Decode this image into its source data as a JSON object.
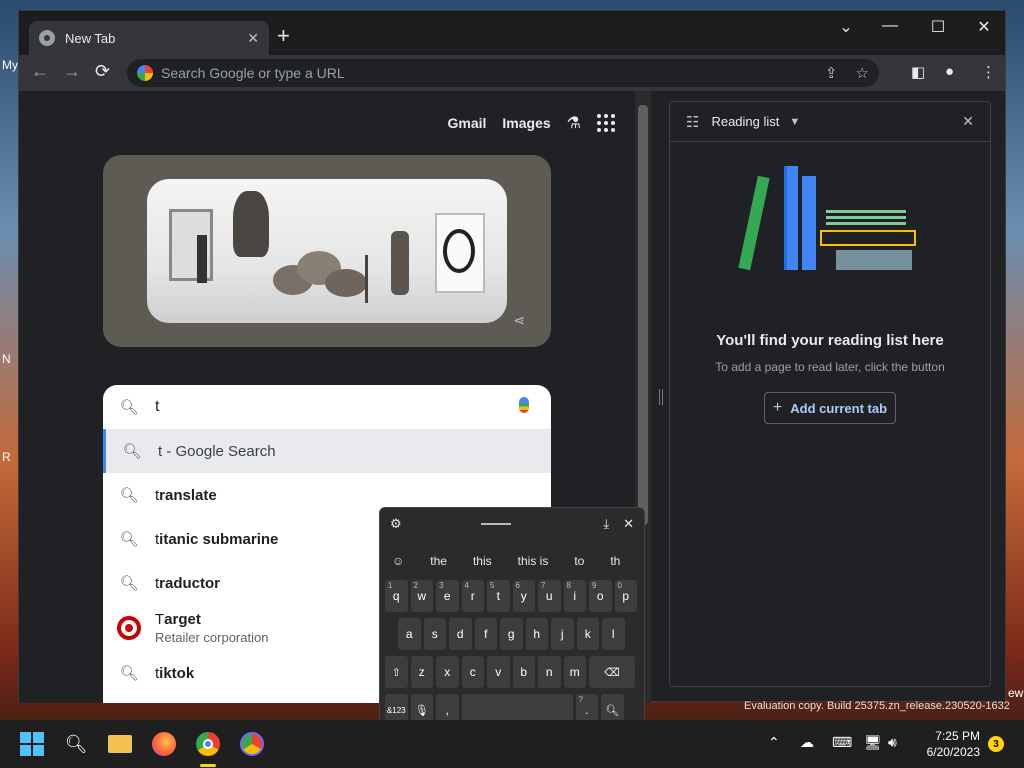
{
  "desktop": {
    "frags": [
      "My",
      "N",
      "R"
    ],
    "right_frag": "ew"
  },
  "tab": {
    "title": "New Tab",
    "close": "✕",
    "new": "+"
  },
  "window_controls": {
    "chevron": "⌄",
    "min": "—",
    "max": "☐",
    "close": "✕"
  },
  "toolbar": {
    "back": "←",
    "forward": "→",
    "reload": "⟳",
    "omnibox_placeholder": "Search Google or type a URL"
  },
  "page": {
    "top_links": [
      "Gmail",
      "Images"
    ],
    "search": {
      "typed": "t",
      "selected": {
        "bold": "t",
        "rest": " - Google Search"
      },
      "suggestions": [
        {
          "prefix": "t",
          "rest": "ranslate"
        },
        {
          "prefix": "t",
          "rest": "itanic submarine"
        },
        {
          "prefix": "t",
          "rest": "raductor"
        },
        {
          "prefix": "T",
          "rest": "arget",
          "sub": "Retailer corporation",
          "logo_text": "target"
        },
        {
          "prefix": "t",
          "rest": "iktok"
        }
      ]
    }
  },
  "side_panel": {
    "title": "Reading list",
    "heading": "You'll find your reading list here",
    "desc": "To add a page to read later, click the button",
    "button": "Add current tab"
  },
  "keyboard": {
    "suggestions": [
      "the",
      "this",
      "this is",
      "to",
      "th"
    ],
    "row1": [
      {
        "k": "q",
        "n": "1"
      },
      {
        "k": "w",
        "n": "2"
      },
      {
        "k": "e",
        "n": "3"
      },
      {
        "k": "r",
        "n": "4"
      },
      {
        "k": "t",
        "n": "5"
      },
      {
        "k": "y",
        "n": "6"
      },
      {
        "k": "u",
        "n": "7"
      },
      {
        "k": "i",
        "n": "8"
      },
      {
        "k": "o",
        "n": "9"
      },
      {
        "k": "p",
        "n": "0"
      }
    ],
    "row2": [
      "a",
      "s",
      "d",
      "f",
      "g",
      "h",
      "j",
      "k",
      "l"
    ],
    "row3": [
      "z",
      "x",
      "c",
      "v",
      "b",
      "n",
      "m"
    ],
    "row4": {
      "mode": "&123",
      "comma": ",",
      "period": ".",
      "period_alt": "?"
    }
  },
  "watermark": "Evaluation copy. Build 25375.zn_release.230520-1632",
  "taskbar": {
    "time": "7:25 PM",
    "date": "6/20/2023",
    "notifications": "3"
  },
  "colors": {
    "accent": "#4285f4",
    "link_blue": "#aecbfa",
    "taskbar_active": "#ffd400"
  }
}
